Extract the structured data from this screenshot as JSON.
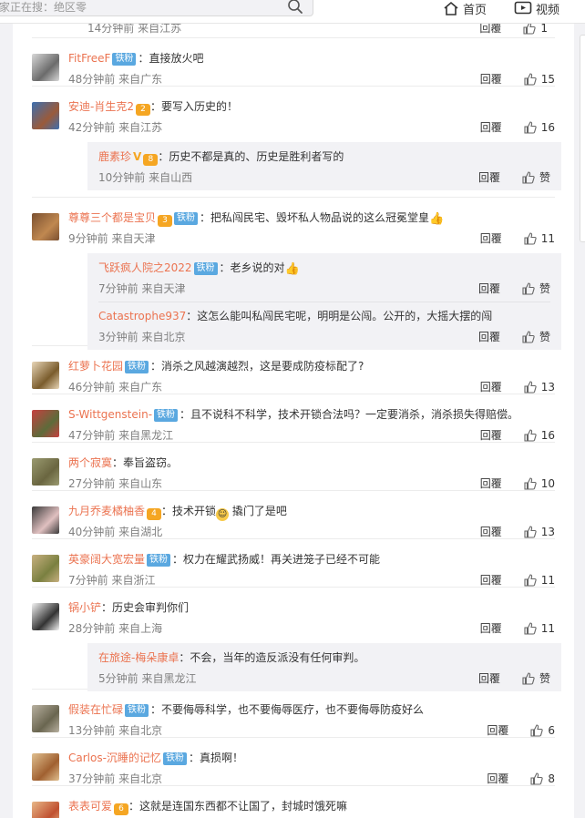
{
  "search": {
    "placeholder": "家正在搜：绝区零"
  },
  "nav": {
    "home": "首页",
    "video": "视频"
  },
  "like_word": "赞",
  "reply_label": "回覆",
  "comments": [
    {
      "meta": "14分钟前 来自江苏",
      "likes": "1",
      "partial": true
    },
    {
      "name": "FitFreeF",
      "badge": "铁粉",
      "text": "：直接放火吧",
      "meta": "48分钟前 来自广东",
      "likes": "15"
    },
    {
      "name": "安迪-肖生克2",
      "vip": "2",
      "text": "：要写入历史的！",
      "meta": "42分钟前 来自江苏",
      "likes": "16",
      "replies": [
        {
          "name": "鹿素珍",
          "vtick": true,
          "vip": "8",
          "text": "：历史不都是真的、历史是胜利者写的",
          "meta": "10分钟前 来自山西",
          "likes": "赞"
        }
      ]
    },
    {
      "name": "尊尊三个都是宝贝",
      "vip": "3",
      "badge": "铁粉",
      "text": "：把私闯民宅、毁坏私人物品说的这么冠冕堂皇",
      "thumbs": true,
      "meta": "9分钟前 来自天津",
      "likes": "11",
      "replies": [
        {
          "name": "飞跃疯人院之2022",
          "badge": "铁粉",
          "text": "：老乡说的对",
          "thumbs": true,
          "meta": "7分钟前 来自天津",
          "likes": "赞"
        },
        {
          "name": "Catastrophe937",
          "text": "：这怎么能叫私闯民宅呢，明明是公闯。公开的，大摇大摆的闯",
          "meta": "3分钟前 来自北京",
          "likes": "赞"
        }
      ]
    },
    {
      "name": "红萝卜花园",
      "badge": "铁粉",
      "text": "：消杀之风越演越烈，这是要成防疫标配了?",
      "meta": "46分钟前 来自广东",
      "likes": "13"
    },
    {
      "name": "S-Wittgenstein-",
      "badge": "铁粉",
      "text": "：且不说科不科学，技术开锁合法吗？一定要消杀，消杀损失得赔偿。",
      "meta": "47分钟前 来自黑龙江",
      "likes": "16"
    },
    {
      "name": "两个寂寞",
      "text": "：奉旨盗窃。",
      "meta": "27分钟前 来自山东",
      "likes": "10"
    },
    {
      "name": "九月乔麦橘柚香",
      "vip": "4",
      "text": "：技术开锁",
      "emo": true,
      "tail": " 撬门了是吧",
      "meta": "40分钟前 来自湖北",
      "likes": "13"
    },
    {
      "name": "英豪阔大宽宏量",
      "badge": "铁粉",
      "text": "：权力在耀武扬威！再关进笼子已经不可能",
      "meta": "7分钟前 来自浙江",
      "likes": "11"
    },
    {
      "name": "锅小铲",
      "text": "：历史会审判你们",
      "meta": "28分钟前 来自上海",
      "likes": "11",
      "replies": [
        {
          "name": "在旅途-梅朵康卓",
          "text": "：不会，当年的造反派没有任何审判。",
          "meta": "5分钟前 来自黑龙江",
          "likes": "赞"
        }
      ]
    },
    {
      "name": "假装在忙碌",
      "badge": "铁粉",
      "text": "：不要侮辱科学，也不要侮辱医疗，也不要侮辱防疫好么",
      "meta": "13分钟前 来自北京",
      "likes": "6"
    },
    {
      "name": "Carlos-沉睡的记忆",
      "badge": "铁粉",
      "text": "：真损啊！",
      "meta": "37分钟前 来自北京",
      "likes": "8"
    },
    {
      "name": "表表可爱",
      "vip": "6",
      "text": "：这就是连国东西都不让国了，封城时饿死嘛",
      "meta": "41分钟前 来自美国",
      "likes": "11"
    }
  ]
}
